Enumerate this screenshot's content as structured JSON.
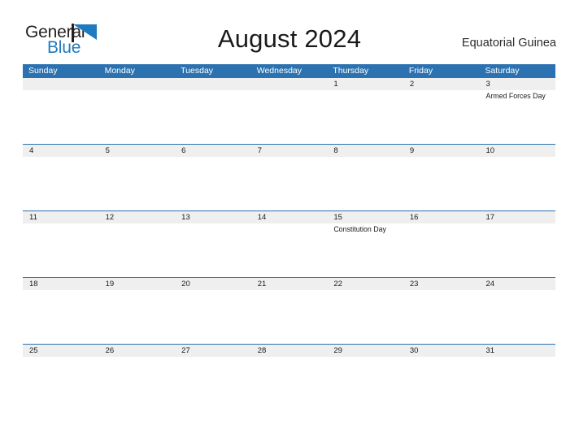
{
  "brand": {
    "name_part1": "General",
    "name_part2": "Blue",
    "icon": "flag-triangle-icon",
    "color_dark": "#231f20",
    "color_blue": "#1f7ac0"
  },
  "header": {
    "title": "August 2024",
    "region": "Equatorial Guinea"
  },
  "colors": {
    "header_blue": "#2c72b0",
    "date_strip_gray": "#efefef",
    "text": "#1a1a1a",
    "header_text": "#ffffff"
  },
  "calendar": {
    "weekdays": [
      "Sunday",
      "Monday",
      "Tuesday",
      "Wednesday",
      "Thursday",
      "Friday",
      "Saturday"
    ],
    "weeks": [
      {
        "days": [
          {
            "date": "",
            "events": []
          },
          {
            "date": "",
            "events": []
          },
          {
            "date": "",
            "events": []
          },
          {
            "date": "",
            "events": []
          },
          {
            "date": "1",
            "events": []
          },
          {
            "date": "2",
            "events": []
          },
          {
            "date": "3",
            "events": [
              "Armed Forces Day"
            ]
          }
        ]
      },
      {
        "days": [
          {
            "date": "4",
            "events": []
          },
          {
            "date": "5",
            "events": []
          },
          {
            "date": "6",
            "events": []
          },
          {
            "date": "7",
            "events": []
          },
          {
            "date": "8",
            "events": []
          },
          {
            "date": "9",
            "events": []
          },
          {
            "date": "10",
            "events": []
          }
        ]
      },
      {
        "days": [
          {
            "date": "11",
            "events": []
          },
          {
            "date": "12",
            "events": []
          },
          {
            "date": "13",
            "events": []
          },
          {
            "date": "14",
            "events": []
          },
          {
            "date": "15",
            "events": [
              "Constitution Day"
            ]
          },
          {
            "date": "16",
            "events": []
          },
          {
            "date": "17",
            "events": []
          }
        ]
      },
      {
        "days": [
          {
            "date": "18",
            "events": []
          },
          {
            "date": "19",
            "events": []
          },
          {
            "date": "20",
            "events": []
          },
          {
            "date": "21",
            "events": []
          },
          {
            "date": "22",
            "events": []
          },
          {
            "date": "23",
            "events": []
          },
          {
            "date": "24",
            "events": []
          }
        ]
      },
      {
        "days": [
          {
            "date": "25",
            "events": []
          },
          {
            "date": "26",
            "events": []
          },
          {
            "date": "27",
            "events": []
          },
          {
            "date": "28",
            "events": []
          },
          {
            "date": "29",
            "events": []
          },
          {
            "date": "30",
            "events": []
          },
          {
            "date": "31",
            "events": []
          }
        ]
      }
    ]
  }
}
